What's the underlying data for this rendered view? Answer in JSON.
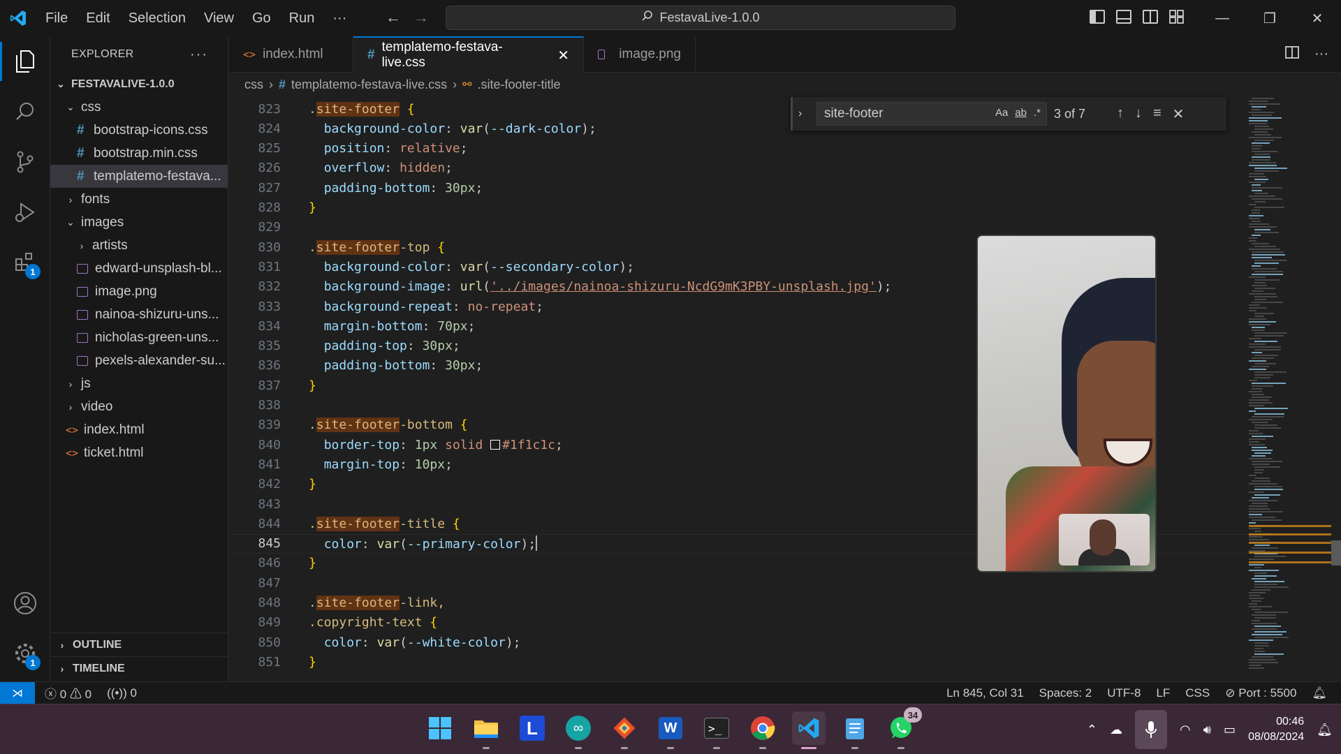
{
  "titlebar": {
    "menu": [
      "File",
      "Edit",
      "Selection",
      "View",
      "Go",
      "Run",
      "···"
    ],
    "search_text": "FestavaLive-1.0.0"
  },
  "sidebar": {
    "title": "EXPLORER",
    "more": "···",
    "root": "FESTAVALIVE-1.0.0",
    "items": [
      {
        "label": "css",
        "kind": "folder-open",
        "indent": 1
      },
      {
        "label": "bootstrap-icons.css",
        "kind": "css",
        "indent": 2
      },
      {
        "label": "bootstrap.min.css",
        "kind": "css",
        "indent": 2
      },
      {
        "label": "templatemo-festava...",
        "kind": "css",
        "indent": 2,
        "selected": true
      },
      {
        "label": "fonts",
        "kind": "folder",
        "indent": 1
      },
      {
        "label": "images",
        "kind": "folder-open",
        "indent": 1
      },
      {
        "label": "artists",
        "kind": "folder",
        "indent": 2
      },
      {
        "label": "edward-unsplash-bl...",
        "kind": "image",
        "indent": 2
      },
      {
        "label": "image.png",
        "kind": "image",
        "indent": 2
      },
      {
        "label": "nainoa-shizuru-uns...",
        "kind": "image",
        "indent": 2
      },
      {
        "label": "nicholas-green-uns...",
        "kind": "image",
        "indent": 2
      },
      {
        "label": "pexels-alexander-su...",
        "kind": "image",
        "indent": 2
      },
      {
        "label": "js",
        "kind": "folder",
        "indent": 1
      },
      {
        "label": "video",
        "kind": "folder",
        "indent": 1
      },
      {
        "label": "index.html",
        "kind": "html",
        "indent": 1
      },
      {
        "label": "ticket.html",
        "kind": "html",
        "indent": 1
      }
    ],
    "outline": "OUTLINE",
    "timeline": "TIMELINE"
  },
  "activity": {
    "extensions_badge": "1",
    "settings_badge": "1"
  },
  "tabs": [
    {
      "label": "index.html",
      "icon": "html"
    },
    {
      "label": "templatemo-festava-live.css",
      "icon": "css",
      "active": true
    },
    {
      "label": "image.png",
      "icon": "image"
    }
  ],
  "breadcrumb": {
    "folder": "css",
    "file": "templatemo-festava-live.css",
    "symbol": ".site-footer-title"
  },
  "find": {
    "query": "site-footer",
    "opt_case": "Aa",
    "opt_word": "ab",
    "opt_regex": ".*",
    "count": "3 of 7"
  },
  "editor": {
    "current_line": 845,
    "lines": [
      {
        "n": "823",
        "t": ".site-footer {"
      },
      {
        "n": "824",
        "t": "  background-color: var(--dark-color);"
      },
      {
        "n": "825",
        "t": "  position: relative;"
      },
      {
        "n": "826",
        "t": "  overflow: hidden;"
      },
      {
        "n": "827",
        "t": "  padding-bottom: 30px;"
      },
      {
        "n": "828",
        "t": "}"
      },
      {
        "n": "829",
        "t": ""
      },
      {
        "n": "830",
        "t": ".site-footer-top {"
      },
      {
        "n": "831",
        "t": "  background-color: var(--secondary-color);"
      },
      {
        "n": "832",
        "t": "  background-image: url('../images/nainoa-shizuru-NcdG9mK3PBY-unsplash.jpg');"
      },
      {
        "n": "833",
        "t": "  background-repeat: no-repeat;"
      },
      {
        "n": "834",
        "t": "  margin-bottom: 70px;"
      },
      {
        "n": "835",
        "t": "  padding-top: 30px;"
      },
      {
        "n": "836",
        "t": "  padding-bottom: 30px;"
      },
      {
        "n": "837",
        "t": "}"
      },
      {
        "n": "838",
        "t": ""
      },
      {
        "n": "839",
        "t": ".site-footer-bottom {"
      },
      {
        "n": "840",
        "t": "  border-top: 1px solid #1f1c1c;"
      },
      {
        "n": "841",
        "t": "  margin-top: 10px;"
      },
      {
        "n": "842",
        "t": "}"
      },
      {
        "n": "843",
        "t": ""
      },
      {
        "n": "844",
        "t": ".site-footer-title {"
      },
      {
        "n": "845",
        "t": "  color: var(--primary-color);"
      },
      {
        "n": "846",
        "t": "}"
      },
      {
        "n": "847",
        "t": ""
      },
      {
        "n": "848",
        "t": ".site-footer-link,"
      },
      {
        "n": "849",
        "t": ".copyright-text {"
      },
      {
        "n": "850",
        "t": "  color: var(--white-color);"
      },
      {
        "n": "851",
        "t": "}"
      }
    ]
  },
  "statusbar": {
    "errors": "0",
    "warnings": "0",
    "ports": "0",
    "position": "Ln 845, Col 31",
    "spaces": "Spaces: 2",
    "encoding": "UTF-8",
    "eol": "LF",
    "language": "CSS",
    "port": "Port : 5500"
  },
  "taskbar": {
    "whatsapp_badge": "34",
    "time": "00:46",
    "date": "08/08/2024"
  },
  "colors": {
    "accent": "#0078d4",
    "editor_bg": "#1f1f1f",
    "taskbar_bg": "#3a2836"
  }
}
